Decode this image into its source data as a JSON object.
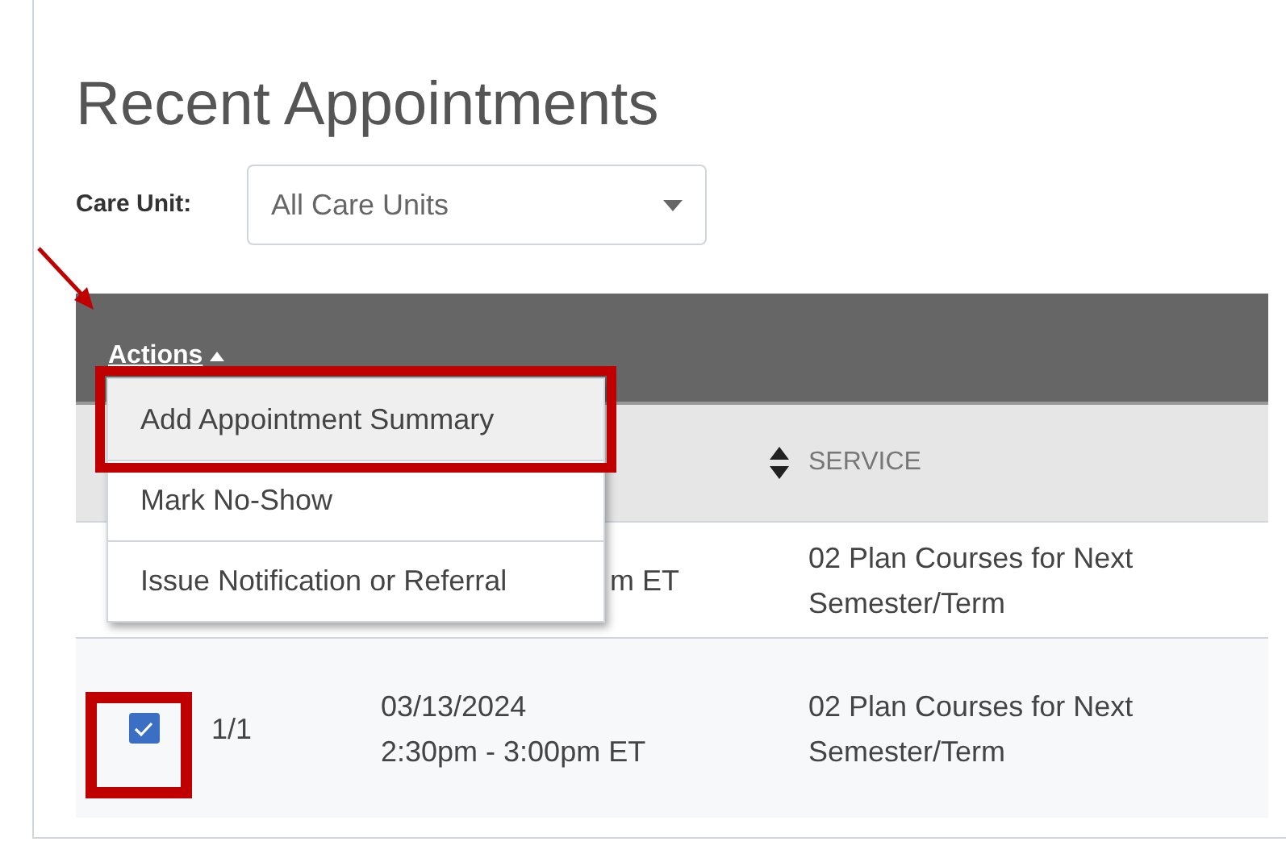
{
  "title": "Recent Appointments",
  "filter": {
    "label": "Care Unit:",
    "value": "All Care Units"
  },
  "actions": {
    "label": "Actions",
    "expanded": true,
    "menu": [
      {
        "label": "Add Appointment Summary",
        "selected": true
      },
      {
        "label": "Mark No-Show",
        "selected": false
      },
      {
        "label": "Issue Notification or Referral",
        "selected": false
      }
    ]
  },
  "table": {
    "service_heading": "SERVICE",
    "rows": [
      {
        "when": [
          "m ET"
        ],
        "service": "02 Plan Courses for Next Semester/Term"
      },
      {
        "checked": true,
        "count": "1/1",
        "when": [
          "03/13/2024",
          "2:30pm - 3:00pm ET"
        ],
        "service": "02 Plan Courses for Next Semester/Term"
      }
    ]
  }
}
